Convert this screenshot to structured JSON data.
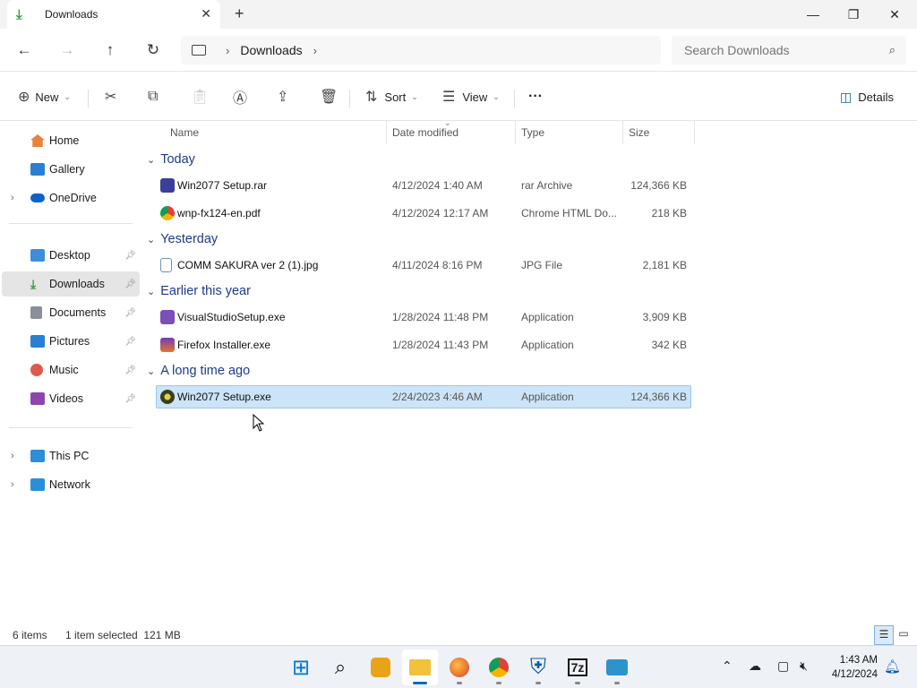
{
  "tab": {
    "title": "Downloads",
    "close": "✕",
    "new": "+"
  },
  "window_controls": {
    "minimize": "—",
    "maximize": "❐",
    "close": "✕"
  },
  "address": {
    "root_icon": "this-pc-icon",
    "breadcrumb": [
      "Downloads"
    ],
    "search_placeholder": "Search Downloads"
  },
  "commands": {
    "new": "New",
    "sort": "Sort",
    "view": "View",
    "more": "···",
    "details": "Details"
  },
  "sidebar": {
    "quick": [
      {
        "label": "Home",
        "icon": "home-icon",
        "color": "#e8833a"
      },
      {
        "label": "Gallery",
        "icon": "gallery-icon",
        "color": "#2a7fd4"
      },
      {
        "label": "OneDrive",
        "icon": "onedrive-icon",
        "color": "#0a63c9",
        "expandable": true
      }
    ],
    "pinned": [
      {
        "label": "Desktop",
        "icon": "desktop-icon",
        "color": "#3b8edb"
      },
      {
        "label": "Downloads",
        "icon": "downloads-icon",
        "color": "#3a9d47",
        "selected": true
      },
      {
        "label": "Documents",
        "icon": "documents-icon",
        "color": "#8a8f99"
      },
      {
        "label": "Pictures",
        "icon": "pictures-icon",
        "color": "#2a7fd4"
      },
      {
        "label": "Music",
        "icon": "music-icon",
        "color": "#e0594e"
      },
      {
        "label": "Videos",
        "icon": "videos-icon",
        "color": "#8e44ad"
      }
    ],
    "devices": [
      {
        "label": "This PC",
        "icon": "this-pc-icon",
        "color": "#2a8fd8"
      },
      {
        "label": "Network",
        "icon": "network-icon",
        "color": "#2a8fd8"
      }
    ]
  },
  "columns": {
    "name": "Name",
    "date": "Date modified",
    "type": "Type",
    "size": "Size"
  },
  "groups": [
    {
      "label": "Today",
      "files": [
        {
          "name": "Win2077 Setup.rar",
          "date": "4/12/2024 1:40 AM",
          "type": "rar Archive",
          "size": "124,366 KB",
          "icon": "winrar-icon",
          "color": "#3a3f99"
        },
        {
          "name": "wnp-fx124-en.pdf",
          "date": "4/12/2024 12:17 AM",
          "type": "Chrome HTML Do...",
          "size": "218 KB",
          "icon": "chrome-icon",
          "color": "#db4437"
        }
      ]
    },
    {
      "label": "Yesterday",
      "files": [
        {
          "name": "COMM SAKURA ver 2 (1).jpg",
          "date": "4/11/2024 8:16 PM",
          "type": "JPG File",
          "size": "2,181 KB",
          "icon": "image-file-icon",
          "color": "#6b8fc9"
        }
      ]
    },
    {
      "label": "Earlier this year",
      "files": [
        {
          "name": "VisualStudioSetup.exe",
          "date": "1/28/2024 11:48 PM",
          "type": "Application",
          "size": "3,909 KB",
          "icon": "visual-studio-icon",
          "color": "#7b4fb8"
        },
        {
          "name": "Firefox Installer.exe",
          "date": "1/28/2024 11:43 PM",
          "type": "Application",
          "size": "342 KB",
          "icon": "firefox-installer-icon",
          "color": "#e8742c"
        }
      ]
    },
    {
      "label": "A long time ago",
      "files": [
        {
          "name": "Win2077 Setup.exe",
          "date": "2/24/2023 4:46 AM",
          "type": "Application",
          "size": "124,366 KB",
          "icon": "win2077-app-icon",
          "color": "#3d3d1a",
          "selected": true
        }
      ]
    }
  ],
  "status": {
    "count": "6 items",
    "selection": "1 item selected  121 MB"
  },
  "taskbar": {
    "apps": [
      {
        "name": "start-button",
        "glyph": "⊞",
        "color": "#0078d4"
      },
      {
        "name": "search-app",
        "glyph": "🔍",
        "color": "#111"
      },
      {
        "name": "copilot-pre-app",
        "glyph": "✦",
        "color": "#e9a31a"
      },
      {
        "name": "file-explorer-app",
        "glyph": "▬",
        "color": "#f3c13a",
        "active": true
      },
      {
        "name": "firefox-app",
        "glyph": "●",
        "color": "#e8742c"
      },
      {
        "name": "chrome-app",
        "glyph": "●",
        "color": "#34a853"
      },
      {
        "name": "defender-app",
        "glyph": "⛨",
        "color": "#0b5cad"
      },
      {
        "name": "7zip-app",
        "glyph": "7z",
        "color": "#111"
      },
      {
        "name": "terminal-app",
        "glyph": "▭",
        "color": "#2e93c9"
      }
    ],
    "time": "1:43 AM",
    "date": "4/12/2024"
  }
}
